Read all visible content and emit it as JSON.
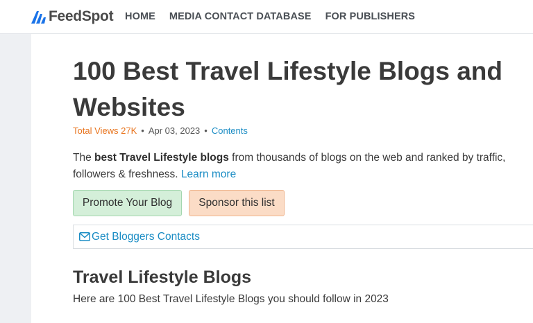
{
  "brand": {
    "name": "FeedSpot",
    "color": "#1a73e8"
  },
  "nav": {
    "items": [
      {
        "label": "HOME"
      },
      {
        "label": "MEDIA CONTACT DATABASE"
      },
      {
        "label": "FOR PUBLISHERS"
      }
    ]
  },
  "article": {
    "title": "100 Best Travel Lifestyle Blogs and Websites",
    "meta": {
      "views": "Total Views 27K",
      "separator": "•",
      "date": "Apr 03, 2023",
      "contents": "Contents"
    },
    "intro": {
      "prefix": "The ",
      "bold": "best Travel Lifestyle blogs",
      "suffix": " from thousands of blogs on the web and ranked by traffic, followers & freshness. ",
      "learn_more": "Learn more"
    },
    "buttons": {
      "promote": "Promote Your Blog",
      "sponsor": "Sponsor this list"
    },
    "contacts": {
      "label": "Get Bloggers Contacts",
      "icon": "envelope-icon"
    },
    "section": {
      "title": "Travel Lifestyle Blogs",
      "description": "Here are 100 Best Travel Lifestyle Blogs you should follow in 2023"
    }
  },
  "colors": {
    "link": "#1a8cc4",
    "views": "#e8731c",
    "promote_bg": "#d4efd9",
    "sponsor_bg": "#fbdcc6"
  }
}
